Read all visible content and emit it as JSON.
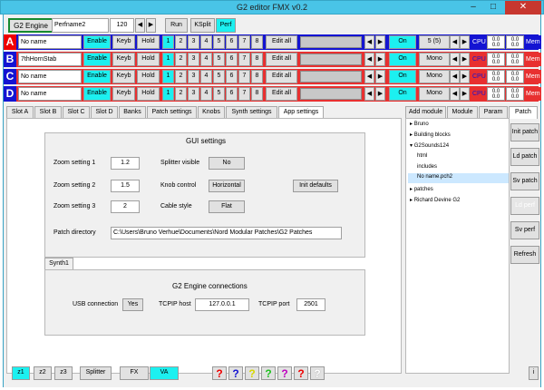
{
  "window": {
    "title": "G2 editor FMX v0.2"
  },
  "toolbar": {
    "engine": "G2 Engine",
    "perf_name": "Perfname2",
    "bpm": "120",
    "run": "Run",
    "ksplit": "KSplit",
    "perf": "Perf"
  },
  "rows": [
    {
      "letter": "A",
      "name": "No name",
      "mode": "Poly",
      "voices": "5 (5)"
    },
    {
      "letter": "B",
      "name": "7thHornStab",
      "mode": "Mono",
      "voices": ""
    },
    {
      "letter": "C",
      "name": "No name",
      "mode": "Mono",
      "voices": ""
    },
    {
      "letter": "D",
      "name": "No name",
      "mode": "Mono",
      "voices": ""
    }
  ],
  "row_labels": {
    "enable": "Enable",
    "keyb": "Keyb",
    "hold": "Hold",
    "edit_all": "Edit all",
    "on": "On",
    "cpu": "CPU",
    "mem": "Mem",
    "cpu_val": "0.0",
    "vars": [
      "1",
      "2",
      "3",
      "4",
      "5",
      "6",
      "7",
      "8"
    ],
    "left": "◀",
    "right": "▶"
  },
  "tabs": [
    "Slot A",
    "Slot B",
    "Slot C",
    "Slot D",
    "Banks",
    "Patch settings",
    "Knobs",
    "Synth settings",
    "App settings"
  ],
  "right_tabs": [
    "Add module",
    "Module",
    "Param",
    "Patch"
  ],
  "gui": {
    "heading": "GUI settings",
    "zoom1_label": "Zoom setting 1",
    "zoom1": "1.2",
    "zoom2_label": "Zoom setting 2",
    "zoom2": "1.5",
    "zoom3_label": "Zoom setting 3",
    "zoom3": "2",
    "splitter_label": "Splitter visible",
    "splitter": "No",
    "knob_label": "Knob control",
    "knob": "Horizontal",
    "cable_label": "Cable style",
    "cable": "Flat",
    "init_defaults": "Init defaults",
    "dir_label": "Patch directory",
    "dir": "C:\\Users\\Bruno Verhue\\Documents\\Nord Modular Patches\\G2 Patches"
  },
  "synth": {
    "tab": "Synth1",
    "heading": "G2 Engine connections",
    "usb_label": "USB connection",
    "usb": "Yes",
    "host_label": "TCPIP host",
    "host": "127.0.0.1",
    "port_label": "TCPIP port",
    "port": "2501"
  },
  "tree": [
    "Bruno",
    "Building blocks",
    "G2Sounds124",
    "html",
    "includes",
    "No name.pch2",
    "patches",
    "Richard Devine G2"
  ],
  "patch_buttons": [
    "Init patch",
    "Ld patch",
    "Sv patch",
    "Ld perf",
    "Sv perf",
    "Refresh"
  ],
  "bottom": {
    "z1": "z1",
    "z2": "z2",
    "z3": "z3",
    "splitter": "Splitter",
    "fx": "FX",
    "va": "VA",
    "info": "i",
    "help_colors": [
      "#e00000",
      "#1414d2",
      "#e8e800",
      "#20c020",
      "#c000c0",
      "#e00000",
      "#ffffff"
    ]
  }
}
